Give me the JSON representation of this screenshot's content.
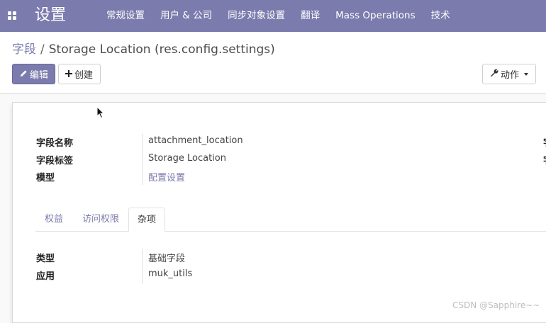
{
  "navbar": {
    "brand": "设置",
    "menu": [
      "常规设置",
      "用户 & 公司",
      "同步对象设置",
      "翻译",
      "Mass Operations",
      "技术"
    ],
    "bg_color": "#7c7bad"
  },
  "breadcrumb": {
    "parent": "字段",
    "separator": "/",
    "current": "Storage Location (res.config.settings)"
  },
  "buttons": {
    "edit": "编辑",
    "create": "创建",
    "action": "动作"
  },
  "form": {
    "fields": [
      {
        "label": "字段名称",
        "value": "attachment_location"
      },
      {
        "label": "字段标签",
        "value": "Storage Location"
      },
      {
        "label": "模型",
        "value": "配置设置"
      }
    ],
    "right_edge_labels": [
      "字",
      "字"
    ],
    "tabs": [
      "权益",
      "访问权限",
      "杂项"
    ],
    "active_tab": "杂项",
    "misc_fields": [
      {
        "label": "类型",
        "value": "基础字段"
      },
      {
        "label": "应用",
        "value": "muk_utils"
      }
    ]
  },
  "watermark": "CSDN @Sapphire~~"
}
